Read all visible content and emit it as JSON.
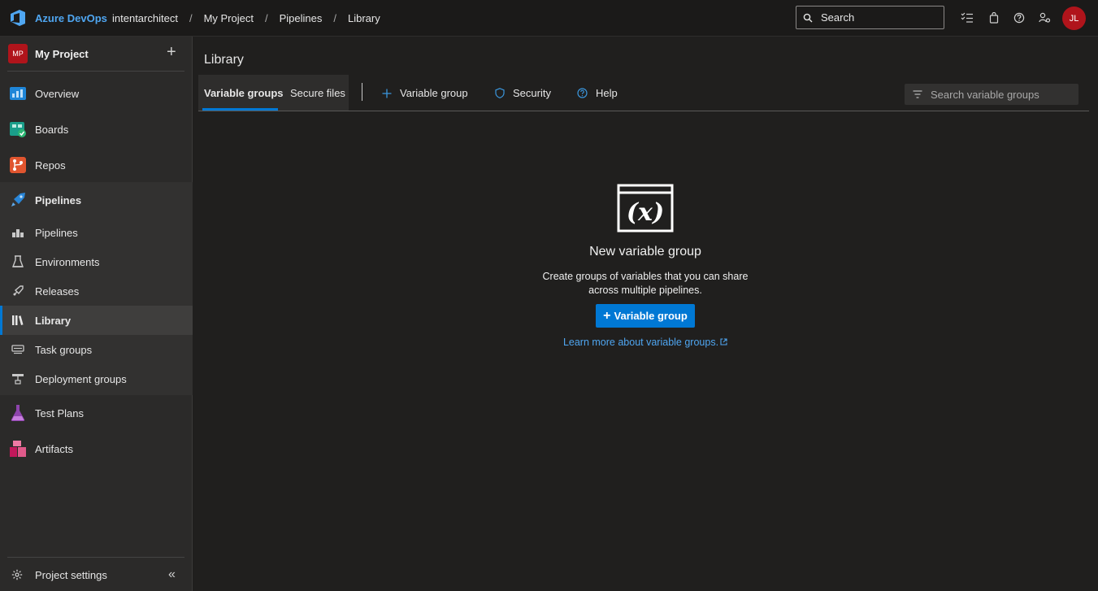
{
  "topbar": {
    "brand": "Azure DevOps",
    "breadcrumbs": [
      "intentarchitect",
      "My Project",
      "Pipelines",
      "Library"
    ],
    "separator": "/",
    "search_placeholder": "Search",
    "icons": [
      "search-icon",
      "task-list-icon",
      "shopping-bag-icon",
      "help-icon",
      "user-settings-icon"
    ],
    "avatar_initials": "JL",
    "avatar_color": "#b0141b"
  },
  "sidebar": {
    "project_badge": "MP",
    "project_name": "My Project",
    "add_symbol": "+",
    "items": [
      {
        "label": "Overview",
        "icon": "overview-icon"
      },
      {
        "label": "Boards",
        "icon": "boards-icon"
      },
      {
        "label": "Repos",
        "icon": "repos-icon"
      },
      {
        "label": "Pipelines",
        "icon": "pipelines-icon"
      },
      {
        "label": "Test Plans",
        "icon": "test-plans-icon"
      },
      {
        "label": "Artifacts",
        "icon": "artifacts-icon"
      }
    ],
    "pipelines_sub": [
      {
        "label": "Pipelines",
        "icon": "pipelines-sub-icon"
      },
      {
        "label": "Environments",
        "icon": "environments-icon"
      },
      {
        "label": "Releases",
        "icon": "releases-icon"
      },
      {
        "label": "Library",
        "icon": "library-icon",
        "active": true
      },
      {
        "label": "Task groups",
        "icon": "task-groups-icon"
      },
      {
        "label": "Deployment groups",
        "icon": "deployment-groups-icon"
      }
    ],
    "settings_label": "Project settings",
    "collapse_symbol": "«"
  },
  "main": {
    "title": "Library",
    "tabs": [
      {
        "label": "Variable groups",
        "active": true
      },
      {
        "label": "Secure files",
        "active": false
      }
    ],
    "commands": [
      {
        "label": "Variable group",
        "icon": "plus-icon"
      },
      {
        "label": "Security",
        "icon": "shield-icon"
      },
      {
        "label": "Help",
        "icon": "help-circle-icon"
      }
    ],
    "filter_placeholder": "Search variable groups"
  },
  "empty_state": {
    "icon_text": "(x)",
    "title": "New variable group",
    "description_line1": "Create groups of variables that you can share",
    "description_line2": "across multiple pipelines.",
    "button_plus": "+",
    "button_label": "Variable group",
    "link_text": "Learn more about variable groups.",
    "accent_color": "#0078d4"
  }
}
